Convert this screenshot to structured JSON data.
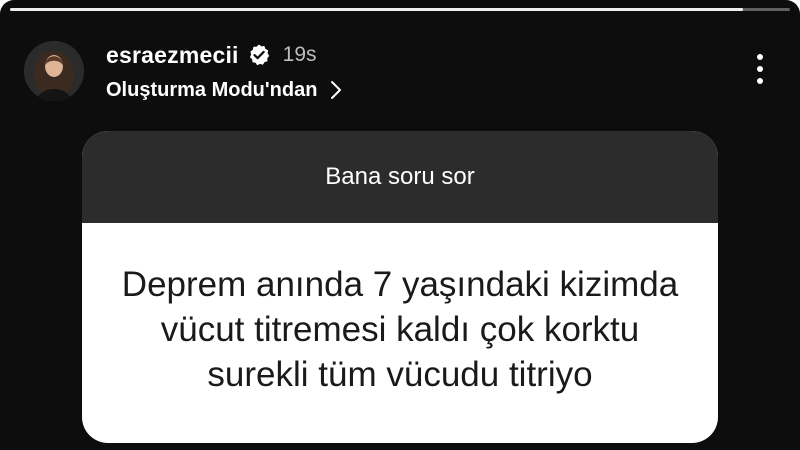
{
  "story": {
    "progress": 0.94
  },
  "header": {
    "avatar_icon": "profile-photo",
    "username": "esraezmecii",
    "verified_icon": "verified-badge-icon",
    "time": "19s",
    "mode_text": "Oluşturma Modu'ndan",
    "chevron_icon": "chevron-right-icon",
    "more_icon": "more-vertical-icon"
  },
  "question_card": {
    "title": "Bana soru sor",
    "answer": "Deprem anında 7 yaşındaki kizimda vücut titremesi kaldı çok korktu surekli tüm vücudu titriyo"
  },
  "colors": {
    "background": "#0d0d0d",
    "card_header": "#2c2c2c",
    "card_body": "#ffffff",
    "text_light": "#ffffff",
    "text_muted": "#bdbdbd",
    "text_dark": "#1a1a1a"
  }
}
